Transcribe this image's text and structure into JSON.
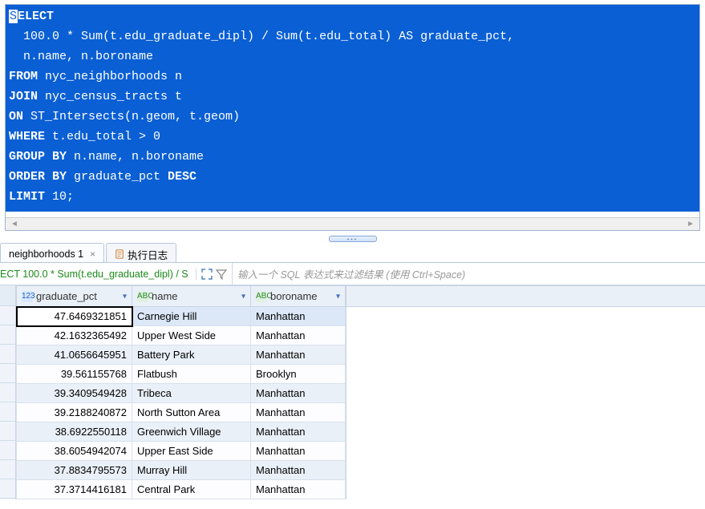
{
  "sql_lines": [
    {
      "t": "SELECT",
      "cls": "kw",
      "inv": true
    },
    {
      "t": "  100.0 * Sum(t.edu_graduate_dipl) / Sum(t.edu_total) AS graduate_pct,",
      "cls": ""
    },
    {
      "t": "  n.name, n.boroname",
      "cls": ""
    },
    {
      "t": "FROM",
      "cls": "kw",
      "rest": " nyc_neighborhoods n"
    },
    {
      "t": "JOIN",
      "cls": "kw",
      "rest": " nyc_census_tracts t"
    },
    {
      "t": "ON",
      "cls": "kw",
      "rest": " ST_Intersects(n.geom, t.geom)"
    },
    {
      "t": "WHERE",
      "cls": "kw",
      "rest": " t.edu_total > 0"
    },
    {
      "t": "GROUP BY",
      "cls": "kw",
      "rest": " n.name, n.boroname"
    },
    {
      "t": "ORDER BY",
      "cls": "kw",
      "rest": " graduate_pct ",
      "tail": "DESC",
      "tailcls": "kw"
    },
    {
      "t": "LIMIT",
      "cls": "kw",
      "rest": " 10;"
    }
  ],
  "tabs": {
    "results_label": "neighborhoods 1",
    "log_label": "执行日志"
  },
  "filter": {
    "sql_snippet": "ECT 100.0 * Sum(t.edu_graduate_dipl) / S",
    "placeholder": "输入一个 SQL 表达式来过滤结果 (使用 Ctrl+Space)"
  },
  "columns": [
    {
      "key": "graduate_pct",
      "label": "graduate_pct",
      "type": "num",
      "icon": "123"
    },
    {
      "key": "name",
      "label": "name",
      "type": "txt",
      "icon": "ABC"
    },
    {
      "key": "boroname",
      "label": "boroname",
      "type": "txt",
      "icon": "ABC"
    }
  ],
  "rows": [
    {
      "graduate_pct": "47.6469321851",
      "name": "Carnegie Hill",
      "boroname": "Manhattan",
      "selected": true
    },
    {
      "graduate_pct": "42.1632365492",
      "name": "Upper West Side",
      "boroname": "Manhattan"
    },
    {
      "graduate_pct": "41.0656645951",
      "name": "Battery Park",
      "boroname": "Manhattan"
    },
    {
      "graduate_pct": "39.561155768",
      "name": "Flatbush",
      "boroname": "Brooklyn"
    },
    {
      "graduate_pct": "39.3409549428",
      "name": "Tribeca",
      "boroname": "Manhattan"
    },
    {
      "graduate_pct": "39.2188240872",
      "name": "North Sutton Area",
      "boroname": "Manhattan"
    },
    {
      "graduate_pct": "38.6922550118",
      "name": "Greenwich Village",
      "boroname": "Manhattan"
    },
    {
      "graduate_pct": "38.6054942074",
      "name": "Upper East Side",
      "boroname": "Manhattan"
    },
    {
      "graduate_pct": "37.8834795573",
      "name": "Murray Hill",
      "boroname": "Manhattan"
    },
    {
      "graduate_pct": "37.3714416181",
      "name": "Central Park",
      "boroname": "Manhattan"
    }
  ]
}
